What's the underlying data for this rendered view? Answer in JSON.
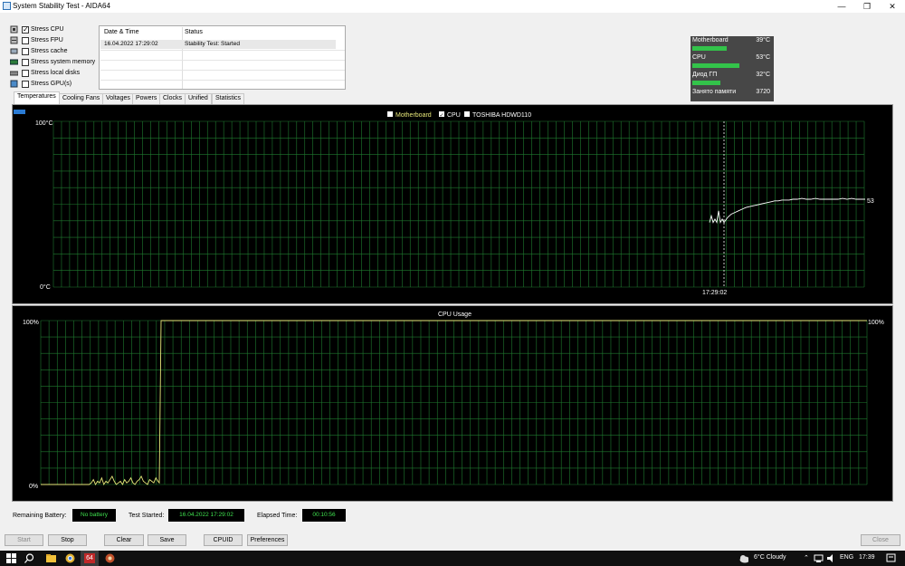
{
  "window": {
    "title": "System Stability Test - AIDA64",
    "minimize_glyph": "—",
    "restore_glyph": "❐",
    "close_glyph": "✕"
  },
  "stress_options": [
    {
      "label": "Stress CPU",
      "checked": true,
      "icon": "cpu-icon"
    },
    {
      "label": "Stress FPU",
      "checked": false,
      "icon": "fpu-icon"
    },
    {
      "label": "Stress cache",
      "checked": false,
      "icon": "cache-icon"
    },
    {
      "label": "Stress system memory",
      "checked": false,
      "icon": "memory-icon"
    },
    {
      "label": "Stress local disks",
      "checked": false,
      "icon": "disk-icon"
    },
    {
      "label": "Stress GPU(s)",
      "checked": false,
      "icon": "gpu-icon"
    }
  ],
  "status_table": {
    "headers": [
      "Date & Time",
      "Status"
    ],
    "rows": [
      [
        "16.04.2022 17:29:02",
        "Stability Test: Started"
      ]
    ]
  },
  "sensors": [
    {
      "name": "Motherboard",
      "value": "39°C",
      "level": 0.39
    },
    {
      "name": "CPU",
      "value": "53°C",
      "level": 0.53
    },
    {
      "name": "Диод ГП",
      "value": "32°C",
      "level": 0.32
    },
    {
      "name": "Занято памяти",
      "value": "3720",
      "level": 0
    }
  ],
  "tabs": [
    "Temperatures",
    "Cooling Fans",
    "Voltages",
    "Powers",
    "Clocks",
    "Unified",
    "Statistics"
  ],
  "active_tab": "Temperatures",
  "temp_chart": {
    "legend": [
      {
        "label": "Motherboard",
        "checked": false
      },
      {
        "label": "CPU",
        "checked": true
      },
      {
        "label": "TOSHIBA HDWD110",
        "checked": false
      }
    ],
    "y_max_label": "100°C",
    "y_min_label": "0°C",
    "time_label": "17:29:02",
    "current_value_label": "53",
    "line_color": "#ffffff",
    "grid_color": "#1f7a2f"
  },
  "cpu_chart": {
    "title": "CPU Usage",
    "y_max_label": "100%",
    "y_min_label": "0%",
    "current_value_label": "100%",
    "line_color": "#e8e87a",
    "grid_color": "#1f7a2f"
  },
  "bottom_info": {
    "battery_label": "Remaining Battery:",
    "battery_value": "No battery",
    "started_label": "Test Started:",
    "started_value": "16.04.2022 17:29:02",
    "elapsed_label": "Elapsed Time:",
    "elapsed_value": "00:10:56"
  },
  "buttons": {
    "start": "Start",
    "stop": "Stop",
    "clear": "Clear",
    "save": "Save",
    "cpuid": "CPUID",
    "preferences": "Preferences",
    "close": "Close"
  },
  "taskbar": {
    "aida_label": "64",
    "weather": "6°C  Cloudy",
    "language": "ENG",
    "time": "17:39"
  }
}
